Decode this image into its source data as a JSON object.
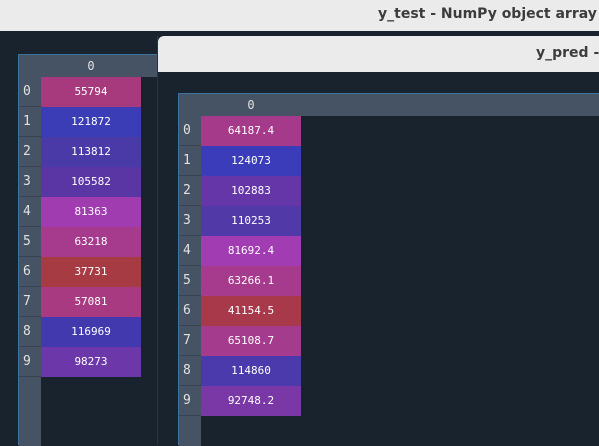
{
  "y_test": {
    "title": "y_test - NumPy object array",
    "column_header": "0",
    "rows": [
      {
        "index": "0",
        "value": "55794",
        "color": "#a73a7d"
      },
      {
        "index": "1",
        "value": "121872",
        "color": "#3b3db7"
      },
      {
        "index": "2",
        "value": "113812",
        "color": "#4a3aa8"
      },
      {
        "index": "3",
        "value": "105582",
        "color": "#5a36a4"
      },
      {
        "index": "4",
        "value": "81363",
        "color": "#a03cb0"
      },
      {
        "index": "5",
        "value": "63218",
        "color": "#a63a8c"
      },
      {
        "index": "6",
        "value": "37731",
        "color": "#a73b43"
      },
      {
        "index": "7",
        "value": "57081",
        "color": "#a73a80"
      },
      {
        "index": "8",
        "value": "116969",
        "color": "#4239ae"
      },
      {
        "index": "9",
        "value": "98273",
        "color": "#6c37a8"
      }
    ]
  },
  "y_pred": {
    "title": "y_pred - N",
    "column_header": "0",
    "rows": [
      {
        "index": "0",
        "value": "64187.4",
        "color": "#a63a8a"
      },
      {
        "index": "1",
        "value": "124073",
        "color": "#3a3cba"
      },
      {
        "index": "2",
        "value": "102883",
        "color": "#6536a8"
      },
      {
        "index": "3",
        "value": "110253",
        "color": "#5139a8"
      },
      {
        "index": "4",
        "value": "81692.4",
        "color": "#a23cb3"
      },
      {
        "index": "5",
        "value": "63266.1",
        "color": "#a63a8c"
      },
      {
        "index": "6",
        "value": "41154.5",
        "color": "#a7394a"
      },
      {
        "index": "7",
        "value": "65108.7",
        "color": "#a53b8c"
      },
      {
        "index": "8",
        "value": "114860",
        "color": "#4b3aab"
      },
      {
        "index": "9",
        "value": "92748.2",
        "color": "#7a38a6"
      }
    ]
  }
}
